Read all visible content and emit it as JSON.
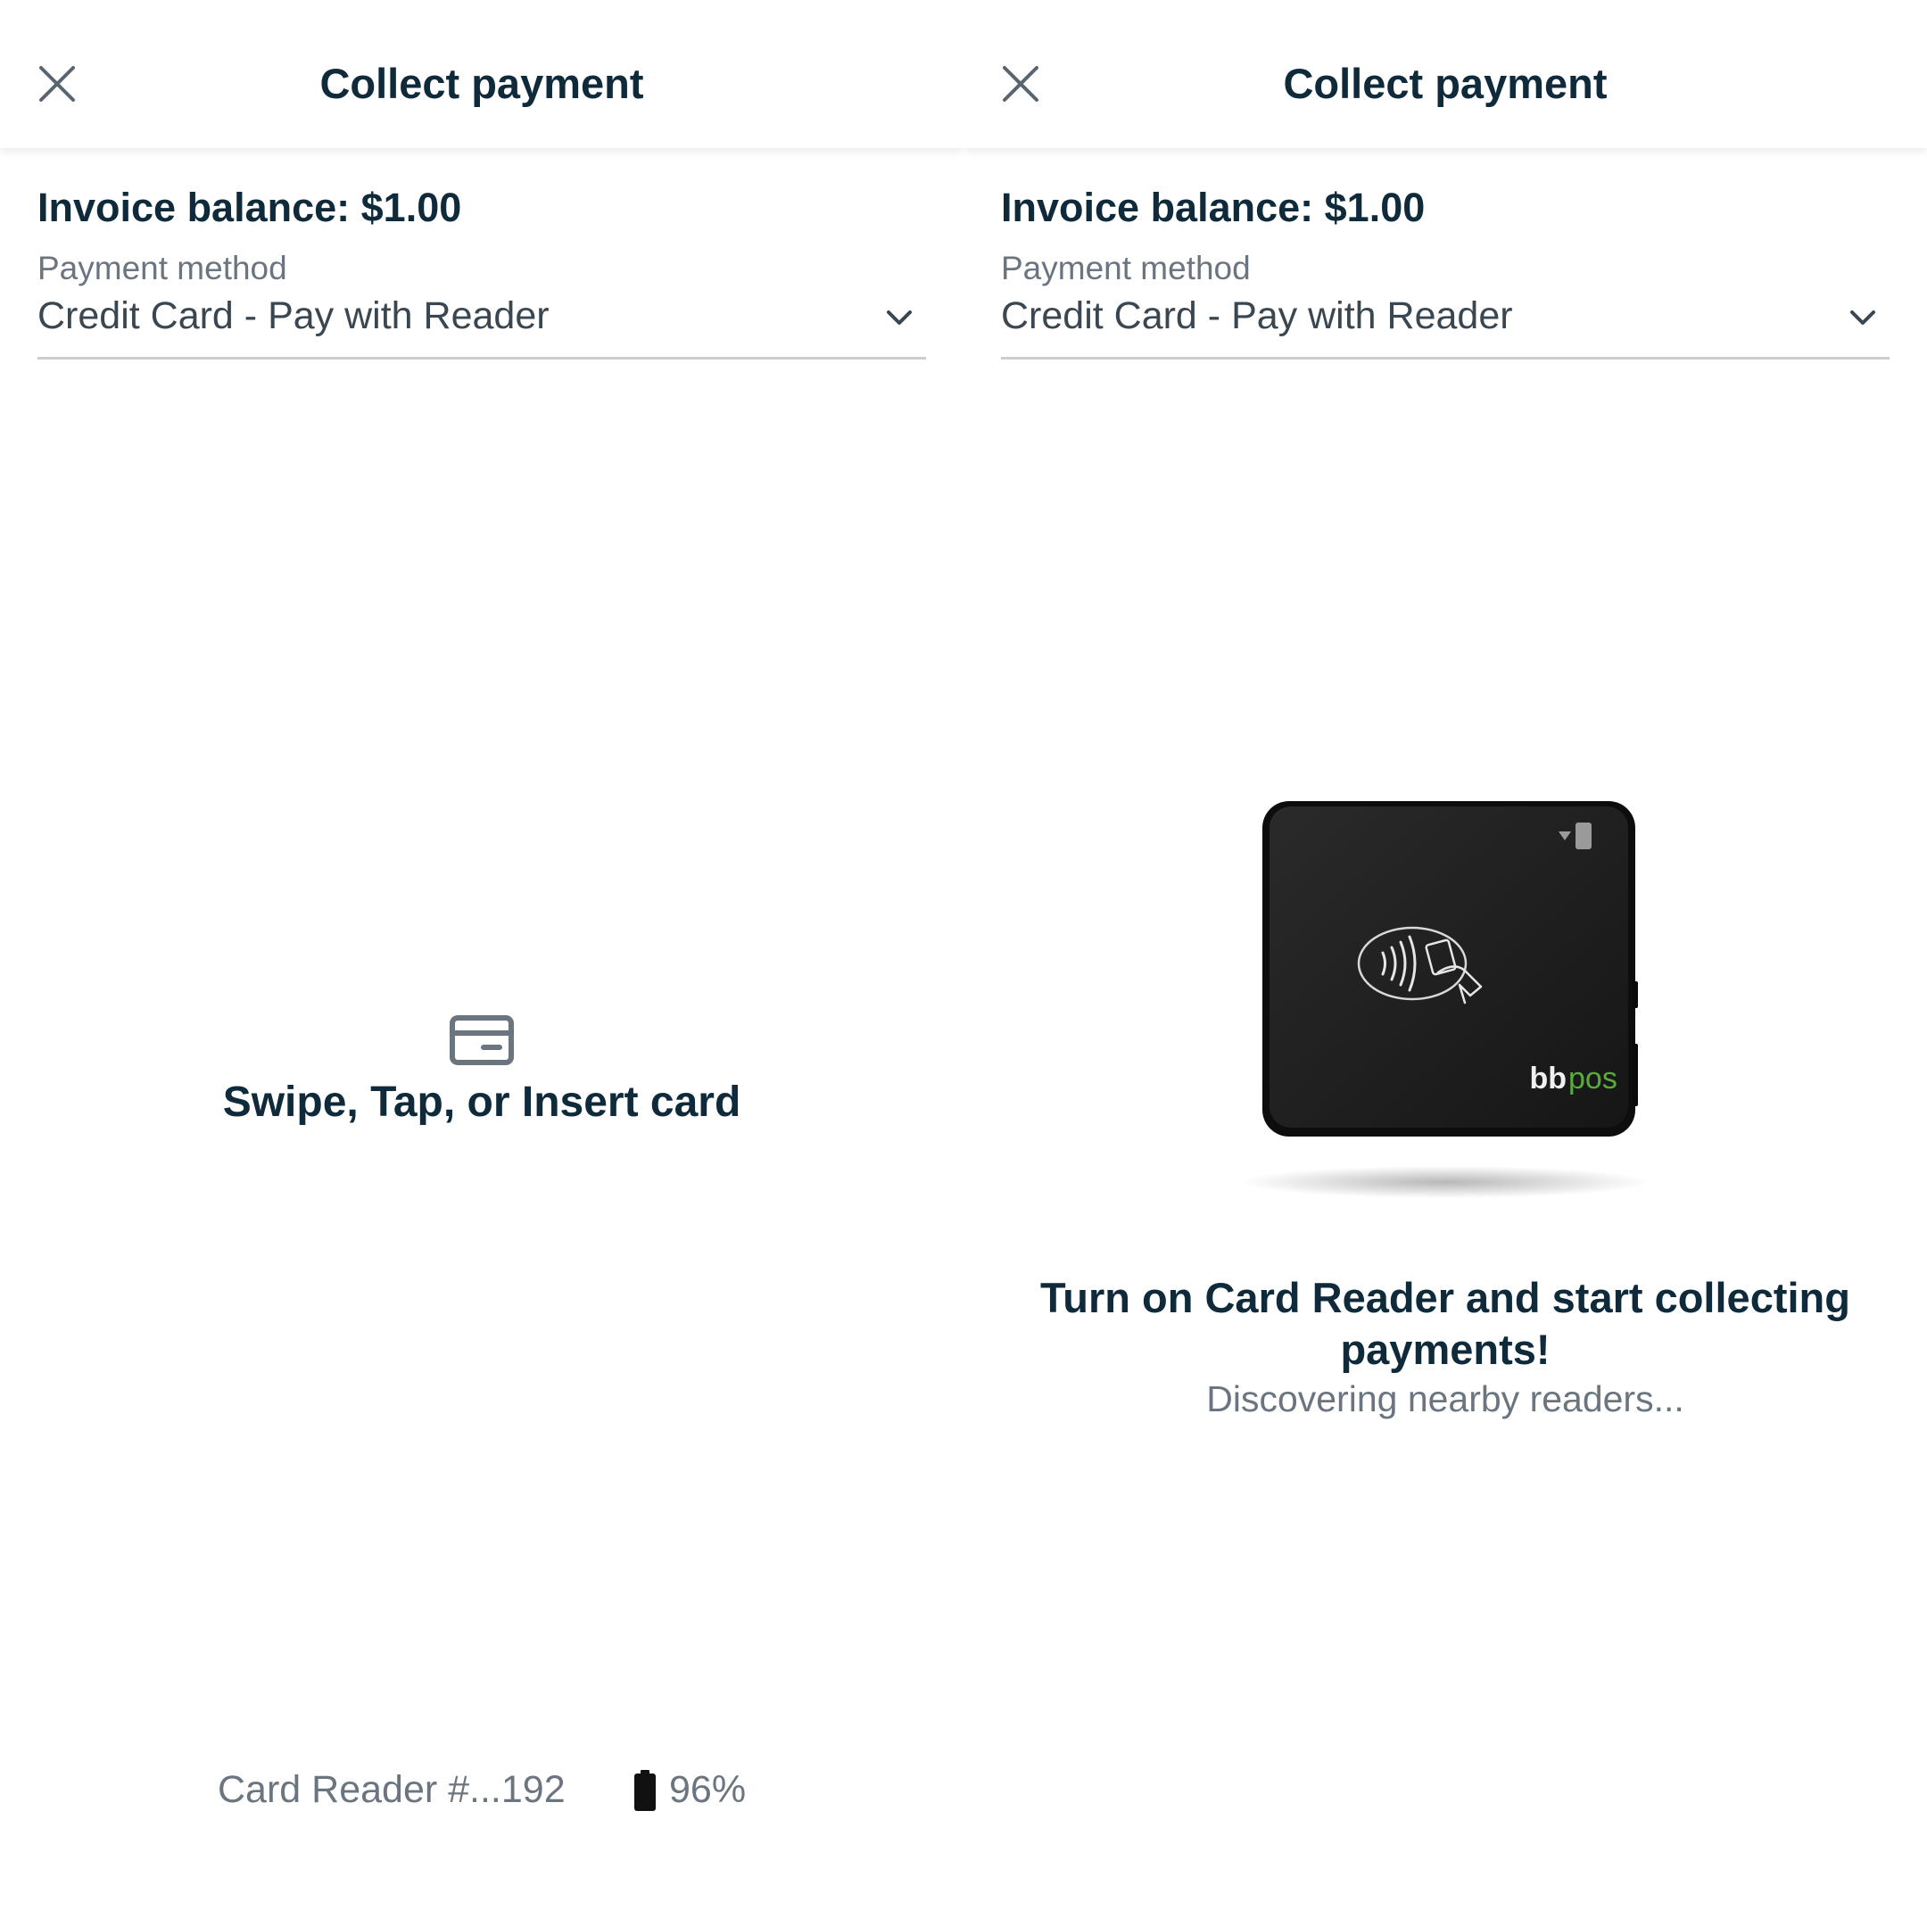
{
  "left_screen": {
    "header": {
      "close_icon": "close-icon",
      "title": "Collect payment"
    },
    "invoice_balance": "Invoice balance: $1.00",
    "payment_method": {
      "label": "Payment method",
      "value": "Credit Card - Pay with Reader",
      "icon": "chevron-down-icon"
    },
    "prompt": {
      "icon": "credit-card-icon",
      "text": "Swipe, Tap, or Insert card"
    },
    "reader_status": {
      "name": "Card Reader #...192",
      "battery_icon": "battery-icon",
      "battery_level": "96%"
    }
  },
  "right_screen": {
    "header": {
      "close_icon": "close-icon",
      "title": "Collect payment"
    },
    "invoice_balance": "Invoice balance: $1.00",
    "payment_method": {
      "label": "Payment method",
      "value": "Credit Card - Pay with Reader",
      "icon": "chevron-down-icon"
    },
    "reader_image": {
      "brand_logo": "bbpos"
    },
    "message": "Turn on Card Reader and start collecting payments!",
    "status": "Discovering nearby readers..."
  },
  "colors": {
    "text_primary": "#0f2a3a",
    "text_secondary": "#6b7580",
    "divider": "#c9ced3",
    "brand_green": "#5aab3c",
    "reader_body": "#1c1c1c"
  }
}
